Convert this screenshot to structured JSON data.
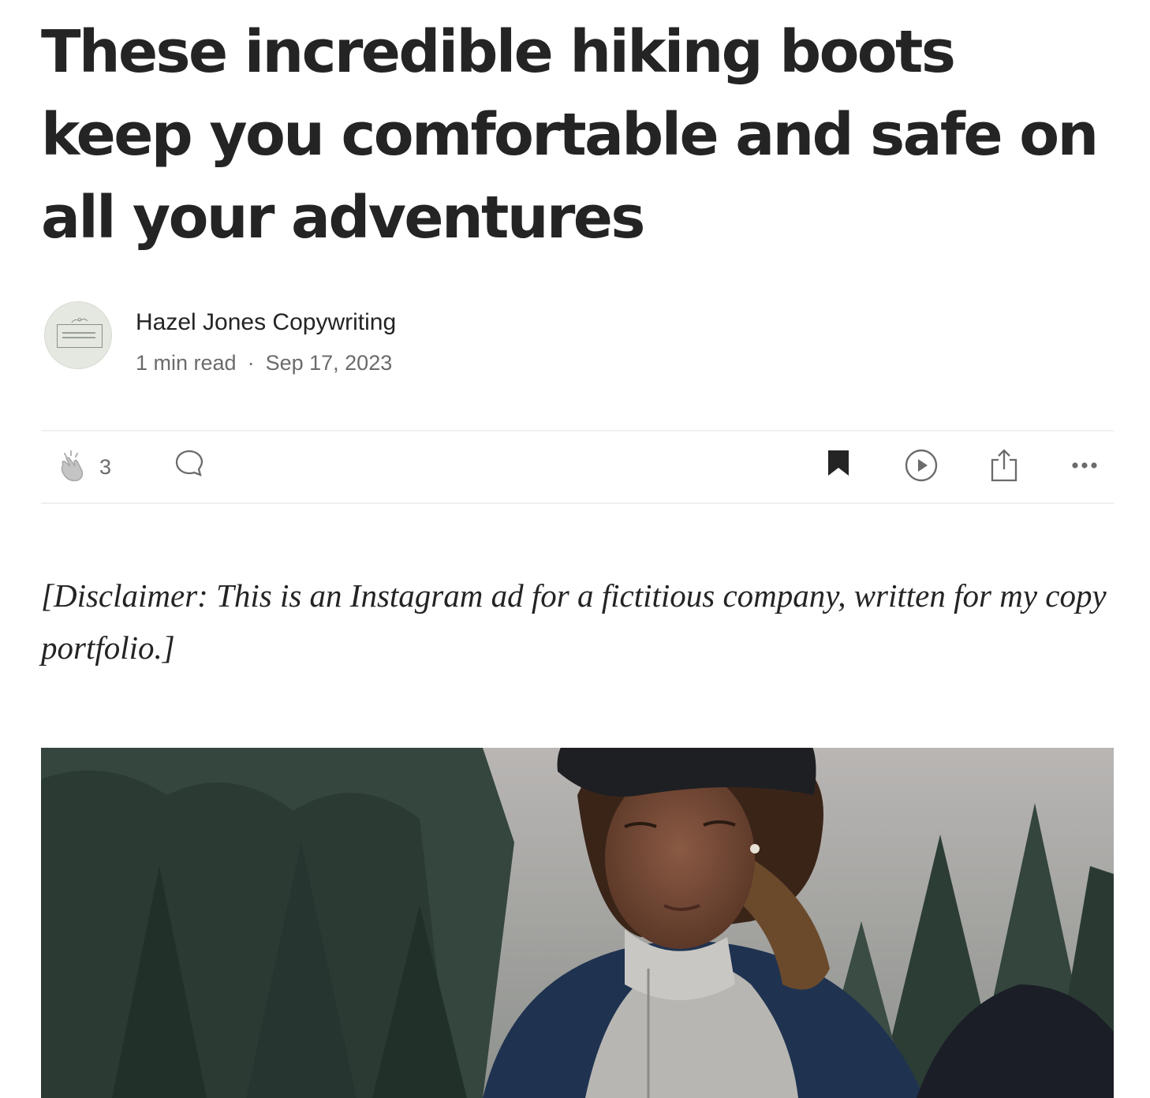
{
  "article": {
    "title": "These incredible hiking boots keep you comfortable and safe on all your adventures",
    "disclaimer": "[Disclaimer: This is an Instagram ad for a fictitious company, written for my copy portfolio.]"
  },
  "author": {
    "name": "Hazel Jones Copywriting",
    "avatar_logo_text": "HAZEL JONES COPYWRITING",
    "read_time": "1 min read",
    "separator": "·",
    "date": "Sep 17, 2023"
  },
  "actions": {
    "clap_count": "3",
    "icons": [
      "clap-icon",
      "comment-icon",
      "bookmark-icon",
      "play-icon",
      "share-icon",
      "more-icon"
    ]
  },
  "colors": {
    "text": "#242424",
    "muted": "#6b6b6b",
    "divider": "#f0f0f0"
  }
}
